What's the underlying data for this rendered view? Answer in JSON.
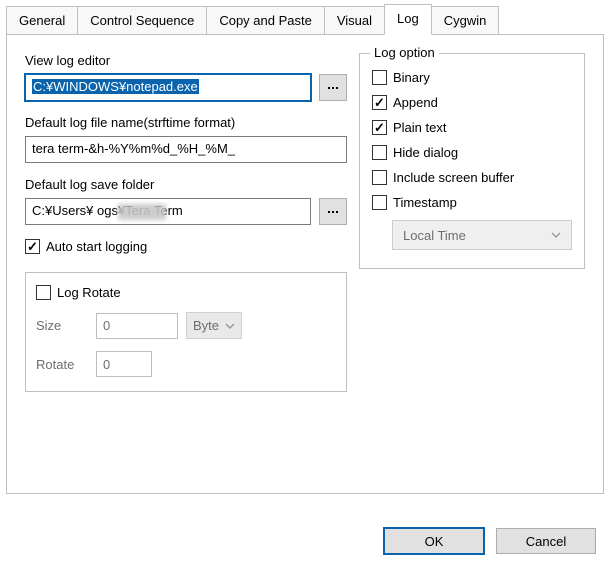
{
  "tabs": {
    "general": "General",
    "ctrl": "Control Sequence",
    "copy": "Copy and Paste",
    "visual": "Visual",
    "log": "Log",
    "cygwin": "Cygwin"
  },
  "left": {
    "view_log_editor_label": "View log editor",
    "view_log_editor_value": "C:¥WINDOWS¥notepad.exe",
    "default_name_label": "Default log file name(strftime format)",
    "default_name_value": "tera term-&h-%Y%m%d_%H_%M_",
    "default_folder_label": "Default log save folder",
    "default_folder_value": "C:¥Users¥            ogs¥Tera Term",
    "auto_start_label": "Auto start logging",
    "rotate_title": "Log Rotate",
    "size_label": "Size",
    "size_value": "0",
    "byte_label": "Byte",
    "rotate_count_label": "Rotate",
    "rotate_count_value": "0"
  },
  "right": {
    "group_title": "Log option",
    "binary": "Binary",
    "append": "Append",
    "plain": "Plain text",
    "hide": "Hide dialog",
    "include": "Include screen buffer",
    "timestamp": "Timestamp",
    "timezone": "Local Time"
  },
  "buttons": {
    "ok": "OK",
    "cancel": "Cancel"
  }
}
